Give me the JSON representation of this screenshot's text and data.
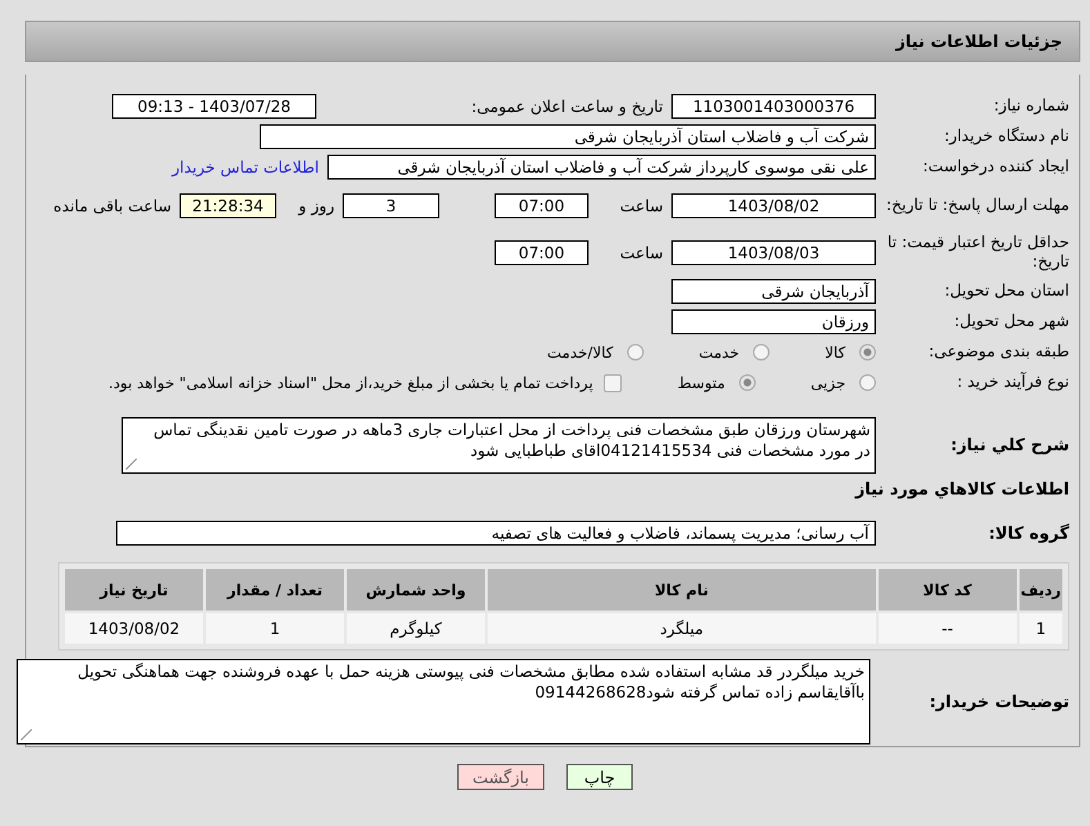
{
  "header": {
    "title": "جزئیات اطلاعات نیاز"
  },
  "need_number": {
    "label": "شماره نیاز:",
    "value": "1103001403000376"
  },
  "announce": {
    "label": "تاریخ و ساعت اعلان عمومی:",
    "value": "1403/07/28 - 09:13"
  },
  "buyer_org": {
    "label": "نام دستگاه خریدار:",
    "value": "شرکت آب و فاضلاب استان آذربایجان شرقی"
  },
  "requester": {
    "label": "ایجاد کننده درخواست:",
    "value": "علی نقی موسوی کارپرداز شرکت آب و فاضلاب استان آذربایجان شرقی",
    "link": "اطلاعات تماس خریدار"
  },
  "reply_deadline": {
    "label": "مهلت ارسال پاسخ: تا تاریخ:",
    "date": "1403/08/02",
    "time_label": "ساعت",
    "time": "07:00",
    "days": "3",
    "days_label": "روز و",
    "remaining": "21:28:34",
    "remaining_label": "ساعت باقی مانده"
  },
  "price_validity": {
    "label": "حداقل تاریخ اعتبار قیمت: تا تاریخ:",
    "date": "1403/08/03",
    "time_label": "ساعت",
    "time": "07:00"
  },
  "province": {
    "label": "استان محل تحویل:",
    "value": "آذربایجان شرقی"
  },
  "city": {
    "label": "شهر محل تحویل:",
    "value": "ورزقان"
  },
  "classification": {
    "label": "طبقه بندی موضوعی:",
    "options": [
      {
        "label": "کالا",
        "selected": true
      },
      {
        "label": "خدمت",
        "selected": false
      },
      {
        "label": "کالا/خدمت",
        "selected": false
      }
    ]
  },
  "purchase_type": {
    "label": "نوع فرآیند خرید :",
    "options": [
      {
        "label": "جزیی",
        "selected": false
      },
      {
        "label": "متوسط",
        "selected": true
      }
    ],
    "payment": {
      "label": "پرداخت تمام یا بخشی از مبلغ خرید،از محل \"اسناد خزانه اسلامی\" خواهد بود.",
      "checked": false
    }
  },
  "description": {
    "label": "شرح كلي نياز:",
    "value": "شهرستان ورزقان  طبق مشخصات فنی پرداخت از محل اعتبارات جاری  3ماهه در صورت تامین نقدینگی تماس در مورد مشخصات فنی 04121415534اقای  طباطبایی  شود"
  },
  "goods_heading": "اطلاعات كالاهاي مورد نياز",
  "goods_group": {
    "label": "گروه کالا:",
    "value": "آب رسانی؛ مدیریت پسماند، فاضلاب و فعالیت های تصفیه"
  },
  "table": {
    "columns": [
      "ردیف",
      "کد کالا",
      "نام کالا",
      "واحد شمارش",
      "تعداد / مقدار",
      "تاریخ نیاز"
    ],
    "rows": [
      [
        "1",
        "--",
        "میلگرد",
        "کیلوگرم",
        "1",
        "1403/08/02"
      ]
    ]
  },
  "buyer_notes": {
    "label": "توضیحات خریدار:",
    "value": "خرید میلگردر قد مشابه استفاده شده مطابق مشخصات فنی پیوستی  هزینه حمل با عهده فروشنده جهت هماهنگی تحویل باآقایقاسم زاده تماس گرفته شود09144268628"
  },
  "buttons": [
    {
      "label": "چاپ",
      "kind": "print"
    },
    {
      "label": "بازگشت",
      "kind": "back"
    }
  ]
}
